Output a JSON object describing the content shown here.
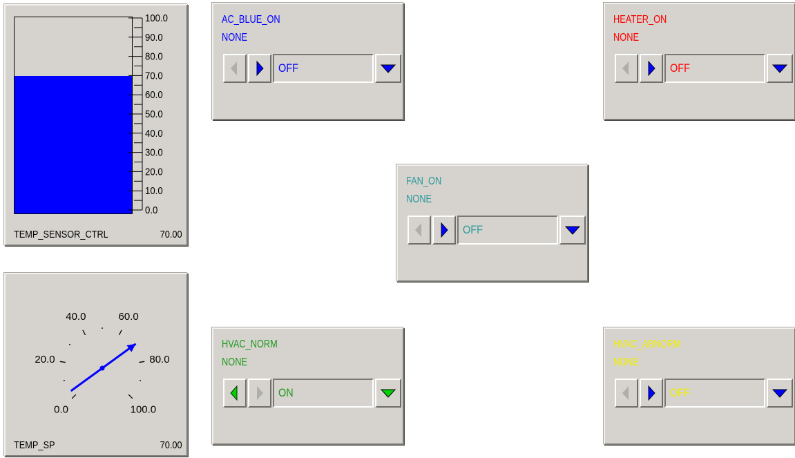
{
  "bar_widget": {
    "label": "TEMP_SENSOR_CTRL",
    "value_text": "70.00",
    "value": 70,
    "range": [
      0,
      100
    ],
    "fill_color": "#0000ff",
    "scale_labels": [
      "100.0",
      "90.0",
      "80.0",
      "70.0",
      "60.0",
      "50.0",
      "40.0",
      "30.0",
      "20.0",
      "10.0",
      "0.0"
    ]
  },
  "meter_widget": {
    "label": "TEMP_SP",
    "value_text": "70.00",
    "value": 70,
    "range": [
      0,
      100
    ],
    "needle_color": "#0000ff",
    "scale_labels": [
      "0.0",
      "20.0",
      "40.0",
      "60.0",
      "80.0",
      "100.0"
    ]
  },
  "enum_widgets": [
    {
      "name": "AC_BLUE_ON",
      "status": "NONE",
      "value": "OFF",
      "color": "#0000ff",
      "prev_enabled": false,
      "next_enabled": true,
      "arrow_color": "#0000ff"
    },
    {
      "name": "HEATER_ON",
      "status": "NONE",
      "value": "OFF",
      "color": "#ff0000",
      "prev_enabled": false,
      "next_enabled": true,
      "arrow_color": "#0000ff"
    },
    {
      "name": "FAN_ON",
      "status": "NONE",
      "value": "OFF",
      "color": "#2a9a9a",
      "prev_enabled": false,
      "next_enabled": true,
      "arrow_color": "#0000ff"
    },
    {
      "name": "HVAC_NORM",
      "status": "NONE",
      "value": "ON",
      "color": "#1e9a1e",
      "prev_enabled": true,
      "next_enabled": false,
      "arrow_color": "#00d000"
    },
    {
      "name": "HVAC_ABNORM",
      "status": "NONE",
      "value": "OFF",
      "color": "#f0f000",
      "prev_enabled": false,
      "next_enabled": true,
      "arrow_color": "#0000ff"
    }
  ]
}
